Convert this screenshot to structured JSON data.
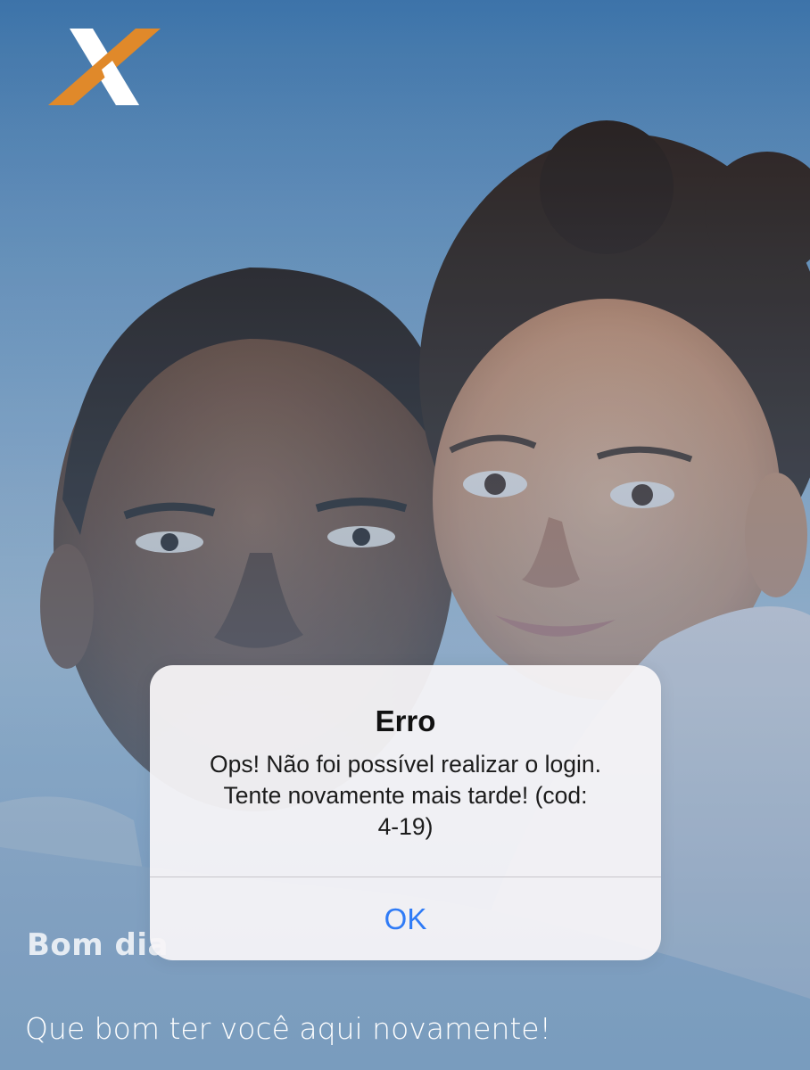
{
  "app": {
    "logo_name": "caixa-x-logo",
    "colors": {
      "logo_orange": "#e0892a",
      "logo_white": "#ffffff",
      "alert_button_blue": "#2f7bf6"
    }
  },
  "background": {
    "greeting": "Bom dia",
    "welcome": "Que bom ter você aqui novamente!"
  },
  "alert": {
    "title": "Erro",
    "message_lines": [
      "Ops! Não foi possível realizar o login.",
      "Tente novamente mais tarde! (cod:",
      "4-19)"
    ],
    "ok_label": "OK"
  }
}
